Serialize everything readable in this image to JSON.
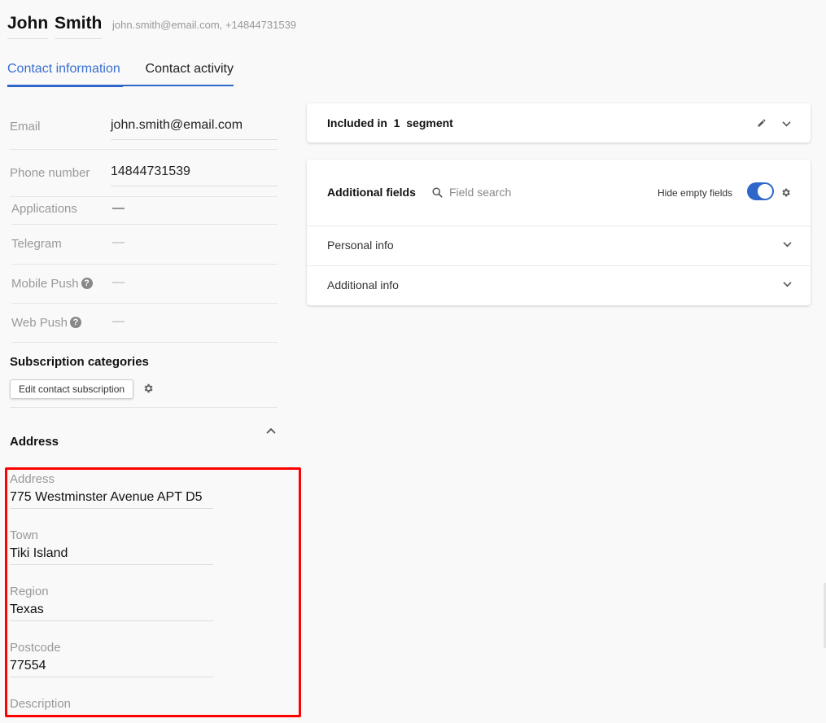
{
  "header": {
    "first_name": "John",
    "last_name": "Smith",
    "subtitle": "john.smith@email.com, +14844731539"
  },
  "tabs": [
    {
      "label": "Contact information",
      "active": true
    },
    {
      "label": "Contact activity",
      "active": false
    }
  ],
  "contact_fields": {
    "email": {
      "label": "Email",
      "value": "john.smith@email.com"
    },
    "phone": {
      "label": "Phone number",
      "value": "14844731539"
    },
    "applications": {
      "label": "Applications",
      "value": "—"
    },
    "telegram": {
      "label": "Telegram",
      "value": "—"
    },
    "mobile_push": {
      "label": "Mobile Push",
      "value": "—",
      "help_icon": "question-circle-icon"
    },
    "web_push": {
      "label": "Web Push",
      "value": "—",
      "help_icon": "question-circle-icon"
    }
  },
  "subscription": {
    "title": "Subscription categories",
    "edit_button": "Edit contact subscription",
    "settings_icon": "gear-icon"
  },
  "address_section": {
    "title": "Address",
    "collapse_icon": "chevron-up-icon",
    "fields": [
      {
        "label": "Address",
        "value": "775 Westminster Avenue APT D5"
      },
      {
        "label": "Town",
        "value": "Tiki Island"
      },
      {
        "label": "Region",
        "value": "Texas"
      },
      {
        "label": "Postcode",
        "value": "77554"
      },
      {
        "label": "Description",
        "value": ""
      }
    ]
  },
  "segments_card": {
    "prefix": "Included in",
    "count": "1",
    "suffix": "segment",
    "edit_icon": "pencil-icon",
    "expand_icon": "chevron-down-icon"
  },
  "additional_fields_card": {
    "title": "Additional fields",
    "search_placeholder": "Field search",
    "search_value": "",
    "hide_empty_label": "Hide empty fields",
    "hide_empty_on": true,
    "settings_icon": "gear-icon",
    "sections": [
      {
        "label": "Personal info",
        "icon": "chevron-down-icon"
      },
      {
        "label": "Additional info",
        "icon": "chevron-down-icon"
      }
    ]
  },
  "colors": {
    "accent": "#2f66c9",
    "highlight_border": "#ff0000",
    "page_bg": "#f9f9f9"
  }
}
